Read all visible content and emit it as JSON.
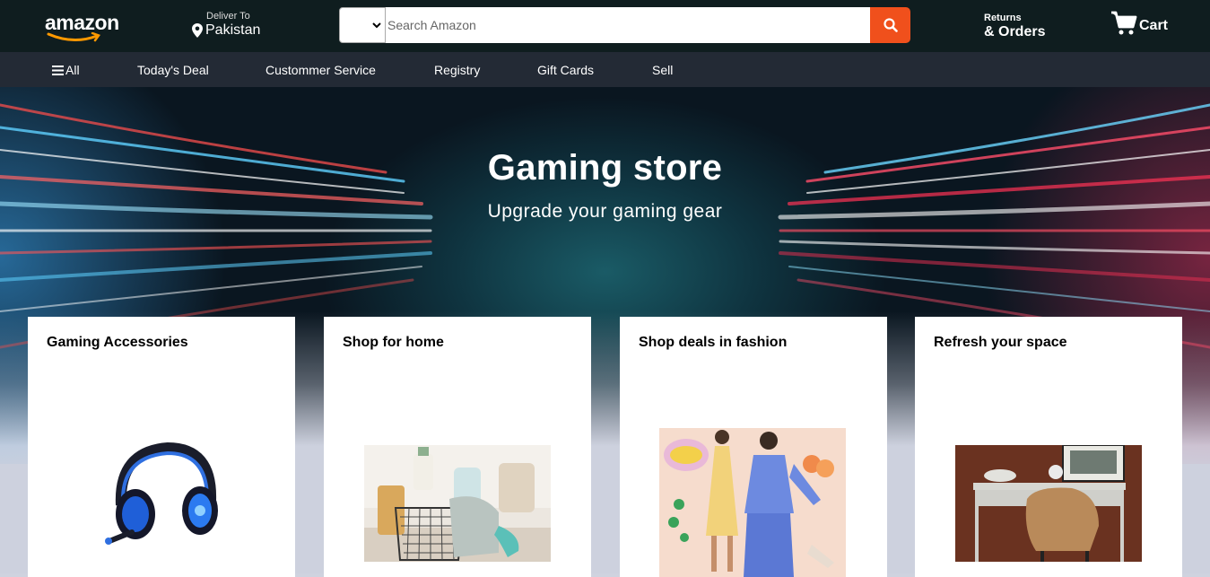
{
  "header": {
    "logo_text": "amazon",
    "deliver_small": "Deliver To",
    "deliver_location": "Pakistan",
    "search_placeholder": "Search Amazon",
    "returns_small": "Returns",
    "returns_big": "& Orders",
    "cart_label": "Cart"
  },
  "nav": {
    "items": [
      "All",
      "Today's Deal",
      "Custommer Service",
      "Registry",
      "Gift Cards",
      "Sell"
    ]
  },
  "hero": {
    "title": "Gaming store",
    "subtitle": "Upgrade your gaming gear"
  },
  "cards": [
    {
      "title": "Gaming Accessories",
      "image": "gaming-headset"
    },
    {
      "title": "Shop for home",
      "image": "cleaning-basket"
    },
    {
      "title": "Shop deals in fashion",
      "image": "fashion-models"
    },
    {
      "title": "Refresh your space",
      "image": "desk-chair"
    }
  ],
  "colors": {
    "header_bg": "#0f1d1f",
    "nav_bg": "#232a35",
    "search_button": "#f0501c",
    "logo_smile": "#ff9900"
  }
}
